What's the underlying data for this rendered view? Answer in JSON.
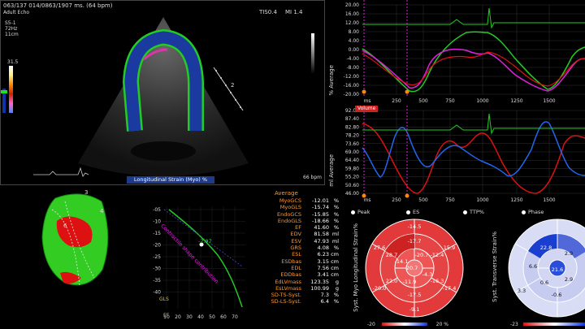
{
  "echo": {
    "header_line1": "063/137 014/0863/1907 ms. (64 bpm)",
    "header_line2": "Adult Echo",
    "tis": "TIS0.4",
    "mi": "MI 1.4",
    "probe_info": [
      "S5-1",
      "72Hz",
      "11cm"
    ],
    "scale_label": "31.5",
    "depth_marker": "2",
    "bpm_label": "66 bpm",
    "caption": "Longitudinal Strain (Myo) %"
  },
  "top_chart": {
    "ylabel": "% Average",
    "yticks": [
      "20.00",
      "16.00",
      "12.00",
      "8.00",
      "4.00",
      "0.00",
      "-4.00",
      "-8.00",
      "-12.00",
      "-16.00",
      "-20.00"
    ],
    "xticks": [
      "ms",
      "250",
      "500",
      "750",
      "1000",
      "1250",
      "1500"
    ]
  },
  "bottom_chart": {
    "tag": "Volume",
    "ylabel": "ml Average",
    "yticks": [
      "92.00",
      "87.40",
      "82.80",
      "78.20",
      "73.60",
      "69.00",
      "64.40",
      "59.80",
      "55.20",
      "50.60",
      "46.00"
    ],
    "xticks": [
      "ms",
      "250",
      "500",
      "750",
      "1000",
      "1250",
      "1500"
    ]
  },
  "legend": {
    "peak": "Peak",
    "es": "ES",
    "ttp": "TTP%",
    "phase": "Phase"
  },
  "metrics": {
    "header": "Average",
    "rows": [
      {
        "k": "MyoGCS",
        "v": "-12.01",
        "u": "%"
      },
      {
        "k": "MyoGLS",
        "v": "-15.74",
        "u": "%"
      },
      {
        "k": "EndoGCS",
        "v": "-15.85",
        "u": "%"
      },
      {
        "k": "EndoGLS",
        "v": "-18.66",
        "u": "%"
      },
      {
        "k": "EF",
        "v": "41.60",
        "u": "%"
      },
      {
        "k": "EDV",
        "v": "81.58",
        "u": "ml"
      },
      {
        "k": "ESV",
        "v": "47.93",
        "u": "ml"
      },
      {
        "k": "GRS",
        "v": "4.08",
        "u": "%"
      },
      {
        "k": "ESL",
        "v": "6.23",
        "u": "cm"
      },
      {
        "k": "ESDbas",
        "v": "3.15",
        "u": "cm"
      },
      {
        "k": "EDL",
        "v": "7.56",
        "u": "cm"
      },
      {
        "k": "EDDbas",
        "v": "3.41",
        "u": "cm"
      },
      {
        "k": "EdLVmass",
        "v": "123.35",
        "u": "g"
      },
      {
        "k": "EsLVmass",
        "v": "100.99",
        "u": "g"
      },
      {
        "k": "SD-TS-Syst.",
        "v": "7.3",
        "u": "%"
      },
      {
        "k": "SD-LS-Syst.",
        "v": "6.4",
        "u": "%"
      }
    ]
  },
  "model3d": {
    "label3": "3",
    "label4": "4",
    "label6": "6"
  },
  "curve": {
    "yticks": [
      "-05",
      "-10",
      "-15",
      "-20",
      "-25",
      "-30",
      "-35",
      "-40"
    ],
    "xticks": [
      "10",
      "20",
      "30",
      "40",
      "50",
      "60",
      "70"
    ],
    "ylabel": "GLS",
    "xlabel": "EF",
    "annotation": "Contractile shape contribution",
    "marker": "-2.97"
  },
  "bullseye1": {
    "ylabel": "Syst. Myo Longitudinal Strain%",
    "scale_left": "-20",
    "scale_right": "20 %",
    "values": {
      "outer": [
        "-14.5",
        "15.9",
        "-17.4",
        "-9.1",
        "-20.0",
        "27.6"
      ],
      "mid": [
        "-17.7",
        "-12.4",
        "-16.3",
        "-17.5",
        "22.0",
        "28.7"
      ],
      "apex": [
        "-20.7",
        "-4.3",
        "-11.9",
        "-14.1"
      ],
      "center": "-20.7",
      "extra": [
        "-19.2",
        "-13.5",
        "-14.5",
        "-16.5"
      ]
    }
  },
  "bullseye2": {
    "ylabel": "Syst. Transverse Strain%",
    "scale_left": "-23",
    "values": [
      "22.8",
      "21.6",
      "2.9",
      "6.6",
      "2.9",
      "0.6",
      "-0.6",
      "3.3"
    ]
  },
  "colors": {
    "green": "#22cc22",
    "magenta": "#dd22dd",
    "red": "#dd1111",
    "blue": "#2266ee",
    "orange": "#ff9a2e"
  }
}
